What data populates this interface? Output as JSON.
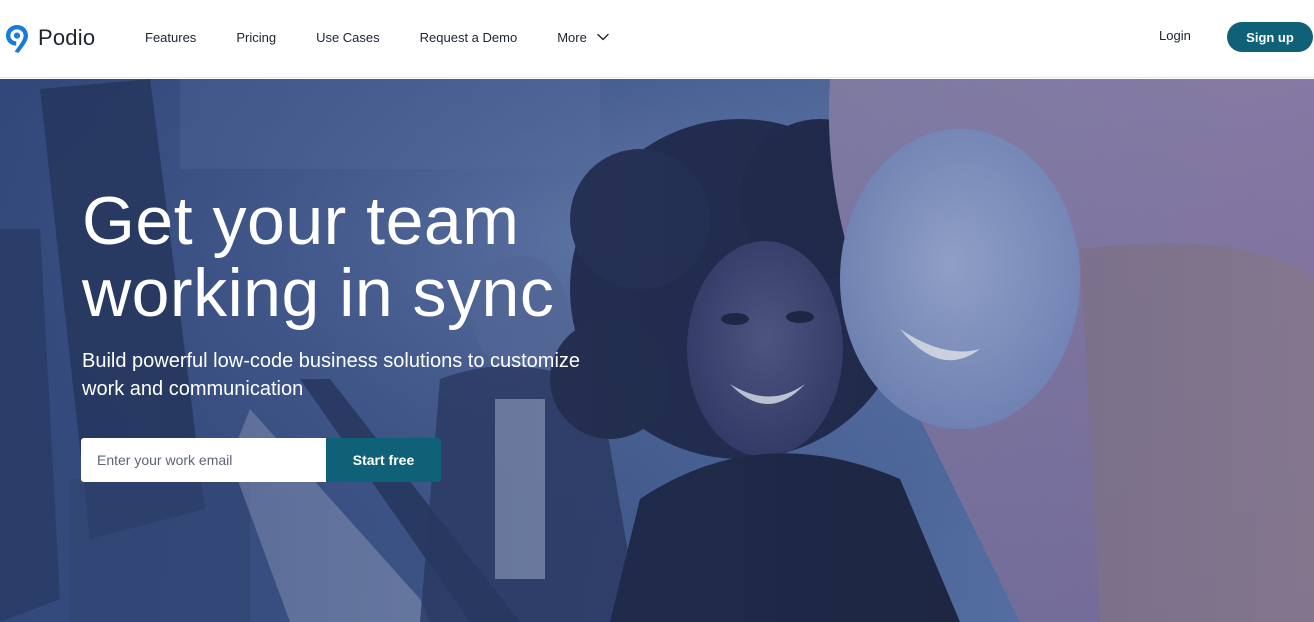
{
  "brand": {
    "name": "Podio",
    "logo_icon": "podio-pin-logo-icon",
    "color": "#1a7bd8"
  },
  "nav": {
    "items": [
      {
        "label": "Features"
      },
      {
        "label": "Pricing"
      },
      {
        "label": "Use Cases"
      },
      {
        "label": "Request a Demo"
      },
      {
        "label": "More",
        "icon": "chevron-down-icon"
      }
    ]
  },
  "auth": {
    "login_label": "Login",
    "signup_label": "Sign up"
  },
  "hero": {
    "title_line1": "Get your team",
    "title_line2": "working in sync",
    "subtitle_line1": "Build powerful low-code business solutions to customize",
    "subtitle_line2": "work and communication",
    "email_placeholder": "Enter your work email",
    "email_value": "",
    "cta_label": "Start free",
    "image": "team-photo"
  },
  "colors": {
    "accent": "#0e6176",
    "hero_tint": "#4b6396",
    "text_dark": "#1c2430"
  }
}
